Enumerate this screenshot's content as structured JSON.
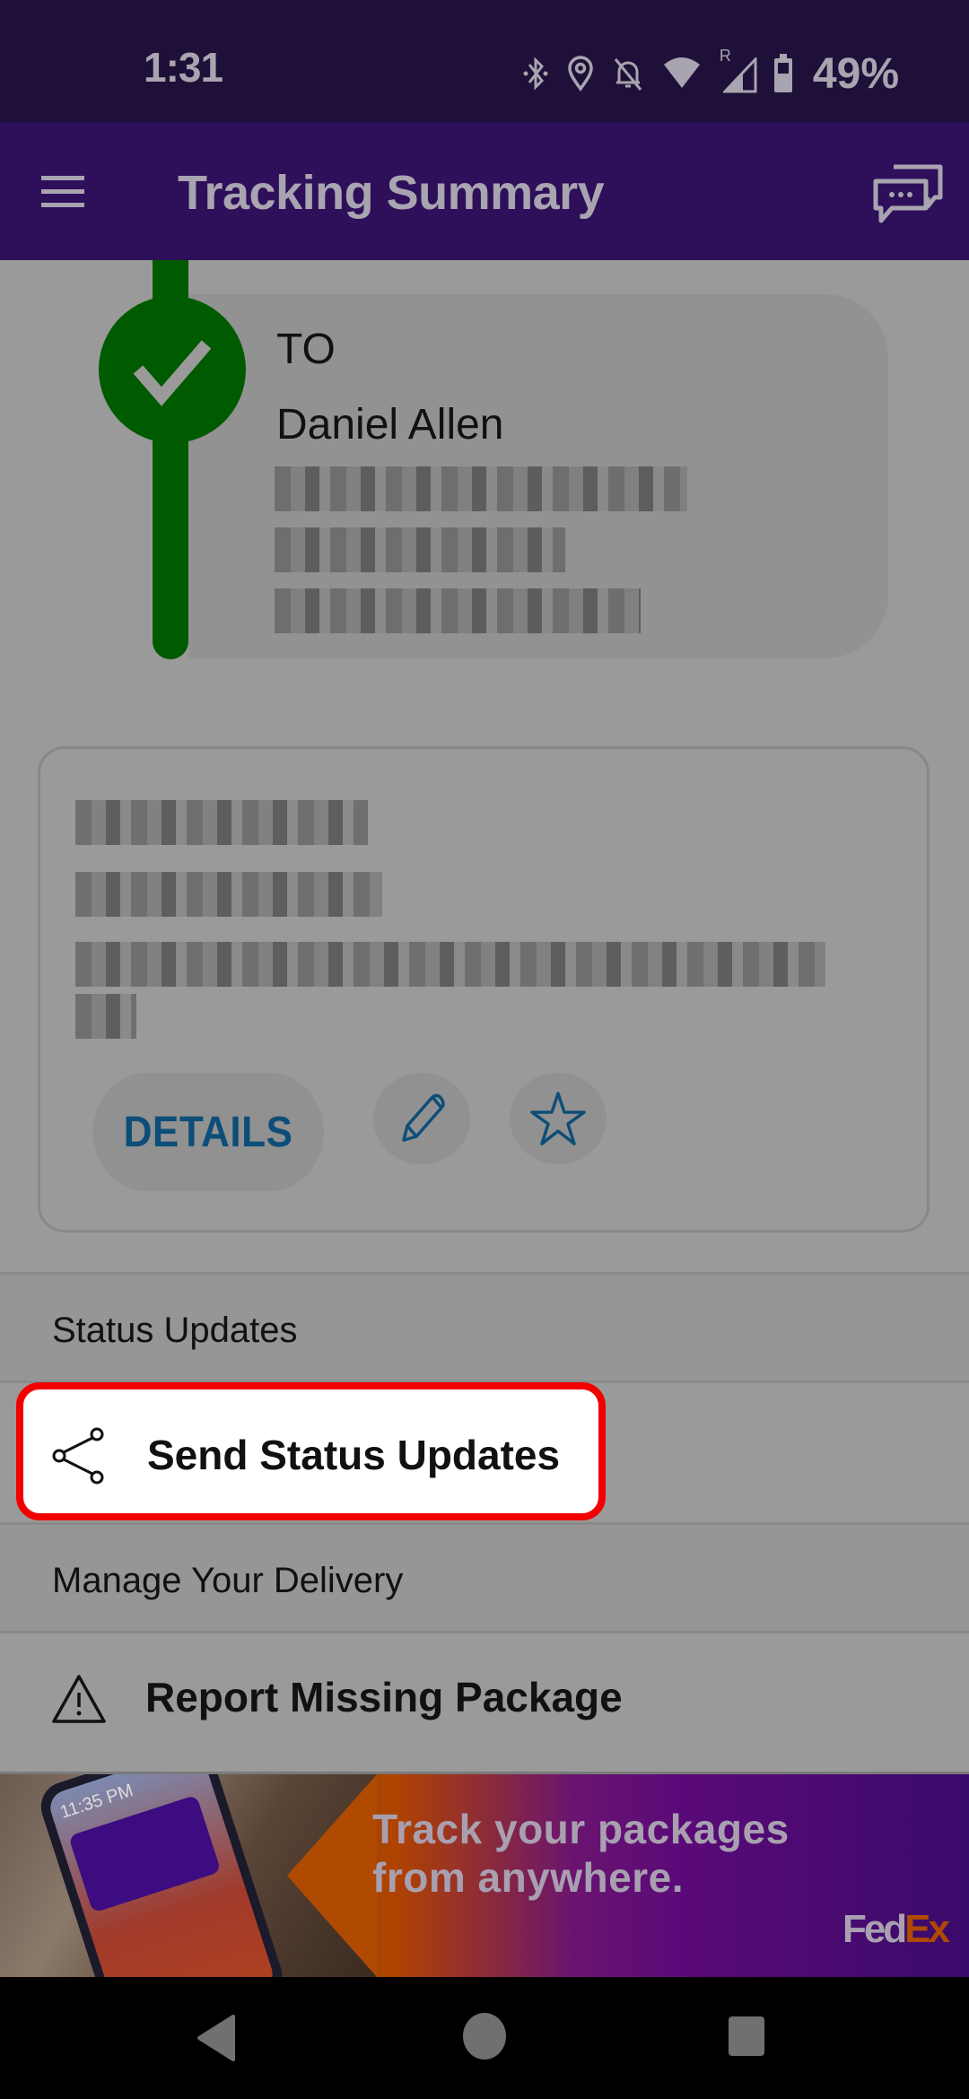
{
  "status_bar": {
    "time": "1:31",
    "icons": [
      "bluetooth-icon",
      "location-icon",
      "notifications-off-icon",
      "wifi-icon",
      "signal-roaming-icon",
      "battery-icon"
    ],
    "roaming_label": "R",
    "battery_percent": "49%"
  },
  "app_bar": {
    "title": "Tracking Summary",
    "menu_icon": "hamburger-menu-icon",
    "chat_icon": "chat-bubbles-icon"
  },
  "recipient": {
    "label": "TO",
    "name": "Daniel Allen",
    "status_icon": "check-icon",
    "status_color": "#005a00",
    "address_lines_redacted": 3
  },
  "shipment_card": {
    "redacted_lines": 4,
    "details_label": "DETAILS",
    "edit_icon": "pencil-icon",
    "favorite_icon": "star-icon",
    "accent_color": "#0d4e78"
  },
  "sections": {
    "status_updates": {
      "header": "Status Updates",
      "items": [
        {
          "label": "Send Status Updates",
          "icon": "share-icon",
          "highlighted": true
        }
      ]
    },
    "manage_delivery": {
      "header": "Manage Your Delivery",
      "items": [
        {
          "label": "Report Missing Package",
          "icon": "warning-icon"
        }
      ]
    }
  },
  "banner": {
    "headline_line1": "Track your packages",
    "headline_line2": "from anywhere.",
    "logo_fed": "Fed",
    "logo_ex": "Ex",
    "phone_time": "11:35 PM"
  },
  "nav_bar": {
    "buttons": [
      "back-icon",
      "home-icon",
      "recents-icon"
    ]
  },
  "highlight_color": "#f20000"
}
